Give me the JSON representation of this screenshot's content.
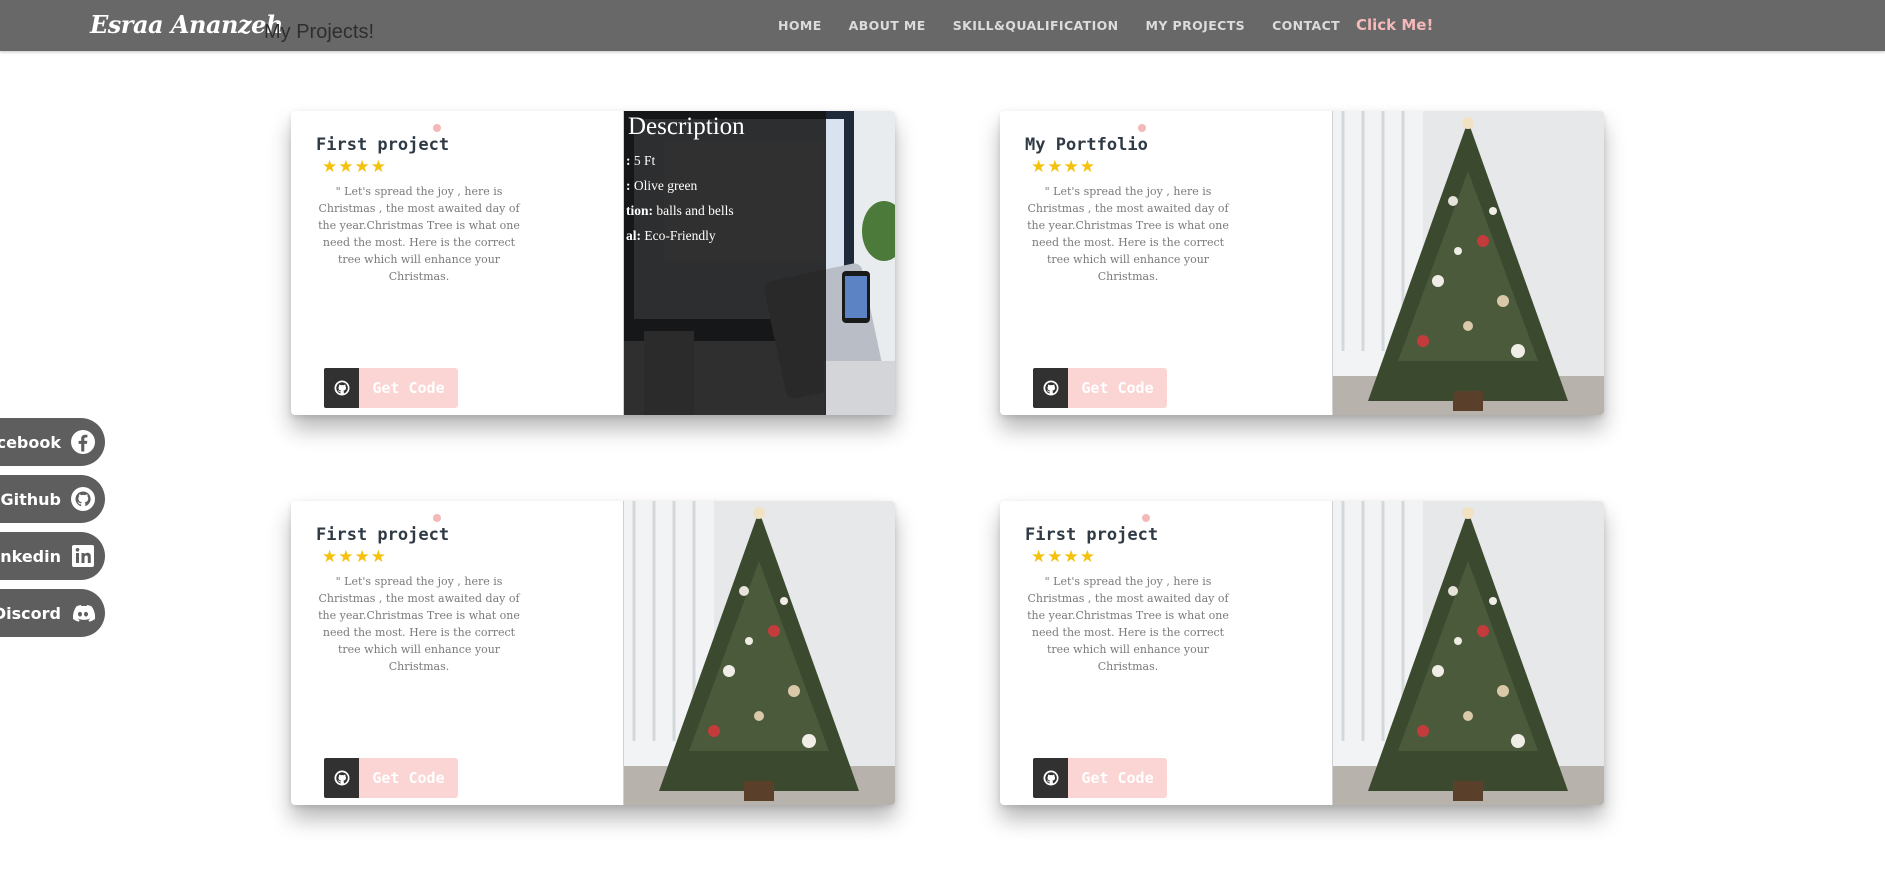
{
  "nav": {
    "brand": "Esraa Ananzeh",
    "page_name": "My Projects!",
    "links": [
      "HOME",
      "ABOUT ME",
      "SKILL&QUALIFICATION",
      "MY PROJECTS",
      "CONTACT"
    ],
    "cta": "Click Me!"
  },
  "social": [
    {
      "label": "Facebook",
      "icon": "facebook-icon"
    },
    {
      "label": "Github",
      "icon": "github-icon"
    },
    {
      "label": "Linkedin",
      "icon": "linkedin-icon"
    },
    {
      "label": "Discord",
      "icon": "discord-icon"
    }
  ],
  "cards": [
    {
      "title": "First project",
      "stars": "★★★★",
      "rating": 4,
      "description": "\" Let's spread the joy , here is Christmas , the most awaited day of the year.Christmas Tree is what one need the most. Here is the correct tree which will enhance your Christmas.",
      "button_label": "Get Code",
      "image": "laptop-desk-photo"
    },
    {
      "title": "My Portfolio",
      "stars": "★★★★",
      "rating": 4,
      "description": "\" Let's spread the joy , here is Christmas , the most awaited day of the year.Christmas Tree is what one need the most. Here is the correct tree which will enhance your Christmas.",
      "button_label": "Get Code",
      "image": "christmas-tree-photo"
    },
    {
      "title": "First project",
      "stars": "★★★★",
      "rating": 4,
      "description": "\" Let's spread the joy , here is Christmas , the most awaited day of the year.Christmas Tree is what one need the most. Here is the correct tree which will enhance your Christmas.",
      "button_label": "Get Code",
      "image": "christmas-tree-photo"
    },
    {
      "title": "First project",
      "stars": "★★★★",
      "rating": 4,
      "description": "\" Let's spread the joy , here is Christmas , the most awaited day of the year.Christmas Tree is what one need the most. Here is the correct tree which will enhance your Christmas.",
      "button_label": "Get Code",
      "image": "christmas-tree-photo"
    }
  ],
  "overlay": {
    "title": "Description",
    "rows": [
      {
        "label": ":",
        "value": "5 Ft"
      },
      {
        "label": ":",
        "value": "Olive green"
      },
      {
        "label": "tion:",
        "value": "balls and bells"
      },
      {
        "label": "al:",
        "value": "Eco-Friendly"
      }
    ]
  },
  "colors": {
    "navbar": "#686868",
    "accent_pink": "#f5b9b9",
    "button_pink": "#fbd4d4",
    "star_gold": "#f4c20d",
    "social_bg": "#5e5e5e"
  }
}
